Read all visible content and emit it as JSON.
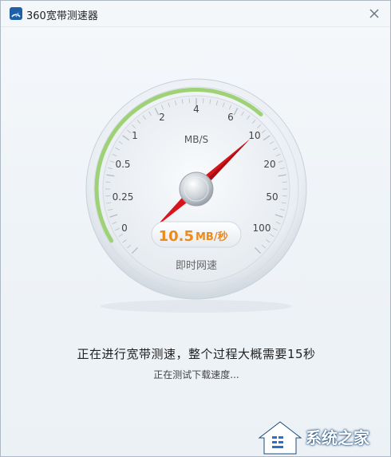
{
  "window": {
    "title": "360宽带测速器"
  },
  "gauge": {
    "unit_label": "MB/S",
    "scale_labels": [
      "0",
      "0.25",
      "0.5",
      "1",
      "2",
      "4",
      "6",
      "10",
      "20",
      "50",
      "100"
    ],
    "readout_value": "10.5",
    "readout_unit": "MB/秒",
    "caption": "即时网速",
    "needle_value_mbps": 10.5,
    "accent_color": "#ee8a1a",
    "needle_color": "#d8141c",
    "arc_color": "#9fd177"
  },
  "status": {
    "main_message": "正在进行宽带测速，整个过程大概需要15秒",
    "sub_message": "正在测试下载速度..."
  },
  "watermark": {
    "text": "系统之家"
  },
  "icons": {
    "app": "speedometer-icon",
    "close": "close-icon",
    "watermark_logo": "house-logo-icon"
  }
}
